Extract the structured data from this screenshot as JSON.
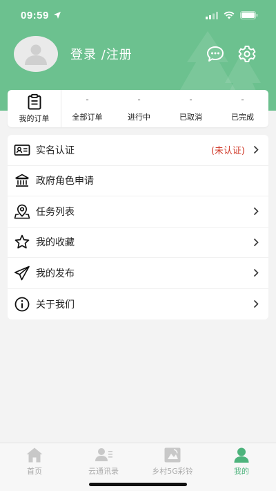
{
  "status_bar": {
    "time": "09:59"
  },
  "profile": {
    "login_text": "登录 /注册"
  },
  "orders": {
    "my_orders_label": "我的订单",
    "stats": [
      {
        "count": "-",
        "label": "全部订单"
      },
      {
        "count": "-",
        "label": "进行中"
      },
      {
        "count": "-",
        "label": "已取消"
      },
      {
        "count": "-",
        "label": "已完成"
      }
    ]
  },
  "menu": {
    "items": [
      {
        "label": "实名认证",
        "icon": "id-card-icon",
        "status": "(未认证)",
        "has_chevron": true
      },
      {
        "label": "政府角色申请",
        "icon": "government-building-icon",
        "status": "",
        "has_chevron": false
      },
      {
        "label": "任务列表",
        "icon": "location-pin-icon",
        "status": "",
        "has_chevron": true
      },
      {
        "label": "我的收藏",
        "icon": "star-icon",
        "status": "",
        "has_chevron": true
      },
      {
        "label": "我的发布",
        "icon": "paper-plane-icon",
        "status": "",
        "has_chevron": true
      },
      {
        "label": "关于我们",
        "icon": "info-icon",
        "status": "",
        "has_chevron": true
      }
    ]
  },
  "tabbar": {
    "tabs": [
      {
        "label": "首页",
        "icon": "home-icon",
        "active": false
      },
      {
        "label": "云通讯录",
        "icon": "contacts-icon",
        "active": false
      },
      {
        "label": "乡村5G彩铃",
        "icon": "ringtone-icon",
        "active": false
      },
      {
        "label": "我的",
        "icon": "user-icon",
        "active": true
      }
    ]
  },
  "colors": {
    "header_green": "#6cc18f",
    "accent_green": "#4db37c",
    "status_red": "#d03a2a"
  }
}
